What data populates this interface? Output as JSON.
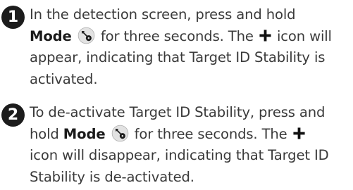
{
  "steps": [
    {
      "number": "1",
      "text_a": "In the detection screen, press and hold",
      "mode_label": "Mode",
      "text_b": "for three seconds. The",
      "text_c": "icon will appear, indicating that Target ID Stability is activated."
    },
    {
      "number": "2",
      "text_a": "To de-activate Target ID Stability, press and hold",
      "mode_label": "Mode",
      "text_b": "for three seconds. The",
      "text_c": "icon will disappear, indicating that Target ID Stability is de-activated."
    }
  ],
  "icons": {
    "mode": "mode-button-icon",
    "plus": "plus-icon"
  },
  "colors": {
    "text": "#3a3a3a",
    "badge": "#1c1c1c"
  }
}
